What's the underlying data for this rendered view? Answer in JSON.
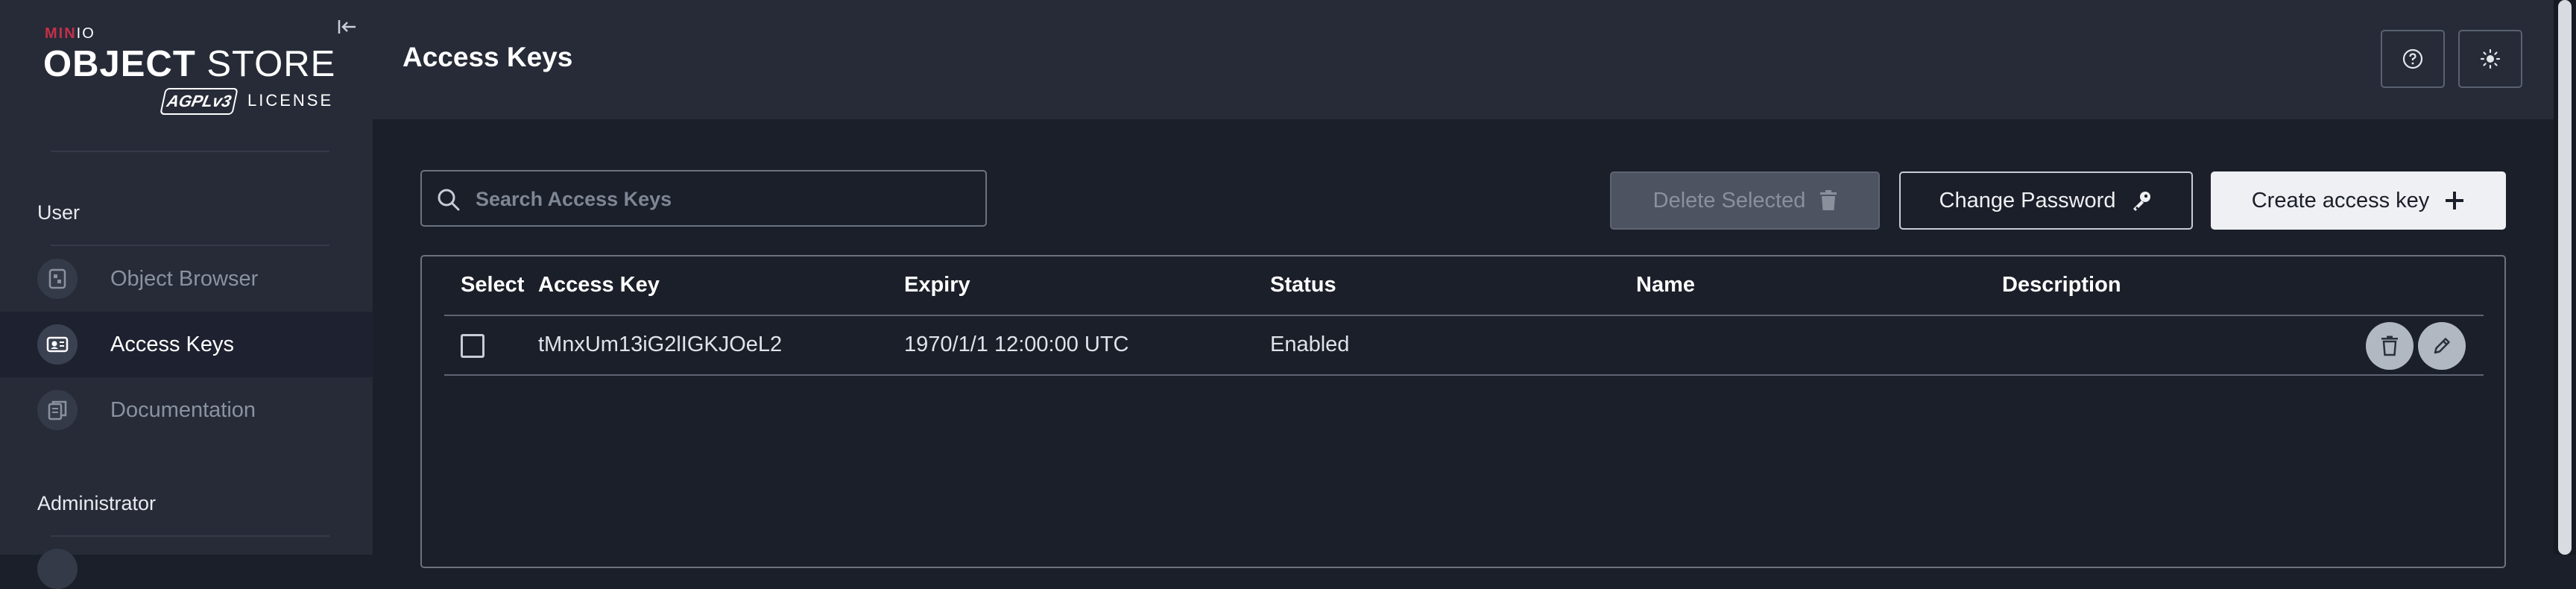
{
  "logo": {
    "brand_main": "MIN",
    "brand_io": "IO",
    "product_bold": "OBJECT",
    "product_thin": " STORE",
    "agpl": "AGPLv3",
    "license": "LICENSE"
  },
  "sidebar": {
    "sections": [
      {
        "label": "User"
      },
      {
        "label": "Administrator"
      }
    ],
    "items": [
      {
        "label": "Object Browser",
        "icon": "object-browser-icon",
        "active": false
      },
      {
        "label": "Access Keys",
        "icon": "access-keys-icon",
        "active": true
      },
      {
        "label": "Documentation",
        "icon": "documentation-icon",
        "active": false
      }
    ]
  },
  "header": {
    "title": "Access Keys",
    "help_icon": "help-circle-icon",
    "theme_icon": "sun-icon"
  },
  "toolbar": {
    "search_placeholder": "Search Access Keys",
    "search_value": "",
    "delete_label": "Delete Selected",
    "change_password_label": "Change Password",
    "create_label": "Create access key"
  },
  "table": {
    "columns": [
      "Select",
      "Access Key",
      "Expiry",
      "Status",
      "Name",
      "Description"
    ],
    "rows": [
      {
        "selected": false,
        "access_key": "tMnxUm13iG2lIGKJOeL2",
        "expiry": "1970/1/1 12:00:00 UTC",
        "status": "Enabled",
        "name": "",
        "description": ""
      }
    ]
  },
  "colors": {
    "background": "#1b1f29",
    "sidebar": "#262b37",
    "brand_red": "#c72e49",
    "primary_button": "#eef0f3"
  }
}
